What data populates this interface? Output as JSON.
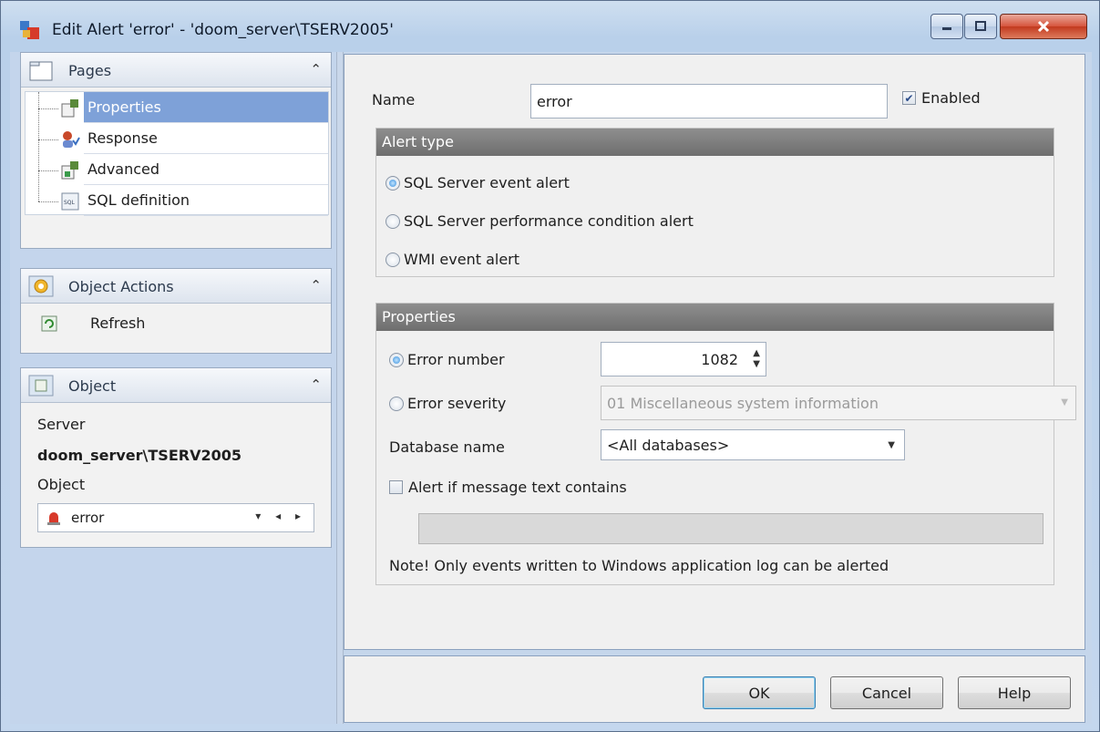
{
  "window": {
    "title": "Edit Alert 'error' - 'doom_server\\TSERV2005'"
  },
  "sidebar": {
    "pages_title": "Pages",
    "pages": [
      {
        "label": "Properties",
        "icon": "properties-icon",
        "selected": true
      },
      {
        "label": "Response",
        "icon": "response-icon",
        "selected": false
      },
      {
        "label": "Advanced",
        "icon": "advanced-icon",
        "selected": false
      },
      {
        "label": "SQL definition",
        "icon": "sql-icon",
        "selected": false
      }
    ],
    "actions_title": "Object Actions",
    "refresh_label": "Refresh",
    "object_title": "Object",
    "server_label": "Server",
    "server_value": "doom_server\\TSERV2005",
    "object_label": "Object",
    "object_value": "error"
  },
  "form": {
    "name_label": "Name",
    "name_value": "error",
    "enabled_label": "Enabled",
    "enabled_checked": true,
    "alert_type_title": "Alert type",
    "alert_types": [
      {
        "label": "SQL Server event alert",
        "checked": true
      },
      {
        "label": "SQL Server performance condition alert",
        "checked": false
      },
      {
        "label": "WMI event alert",
        "checked": false
      }
    ],
    "properties_title": "Properties",
    "error_number_label": "Error number",
    "error_number_value": "1082",
    "error_severity_label": "Error severity",
    "error_severity_value": "01 Miscellaneous system information",
    "database_label": "Database name",
    "database_value": "<All databases>",
    "alert_text_label": "Alert if message text contains",
    "message_text_value": "",
    "note": "Note! Only events written to Windows application log can be alerted"
  },
  "buttons": {
    "ok": "OK",
    "cancel": "Cancel",
    "help": "Help"
  },
  "colors": {
    "selection": "#7ea1d8",
    "frame_header": "#7a7a7a",
    "close_button": "#c23a1f"
  }
}
